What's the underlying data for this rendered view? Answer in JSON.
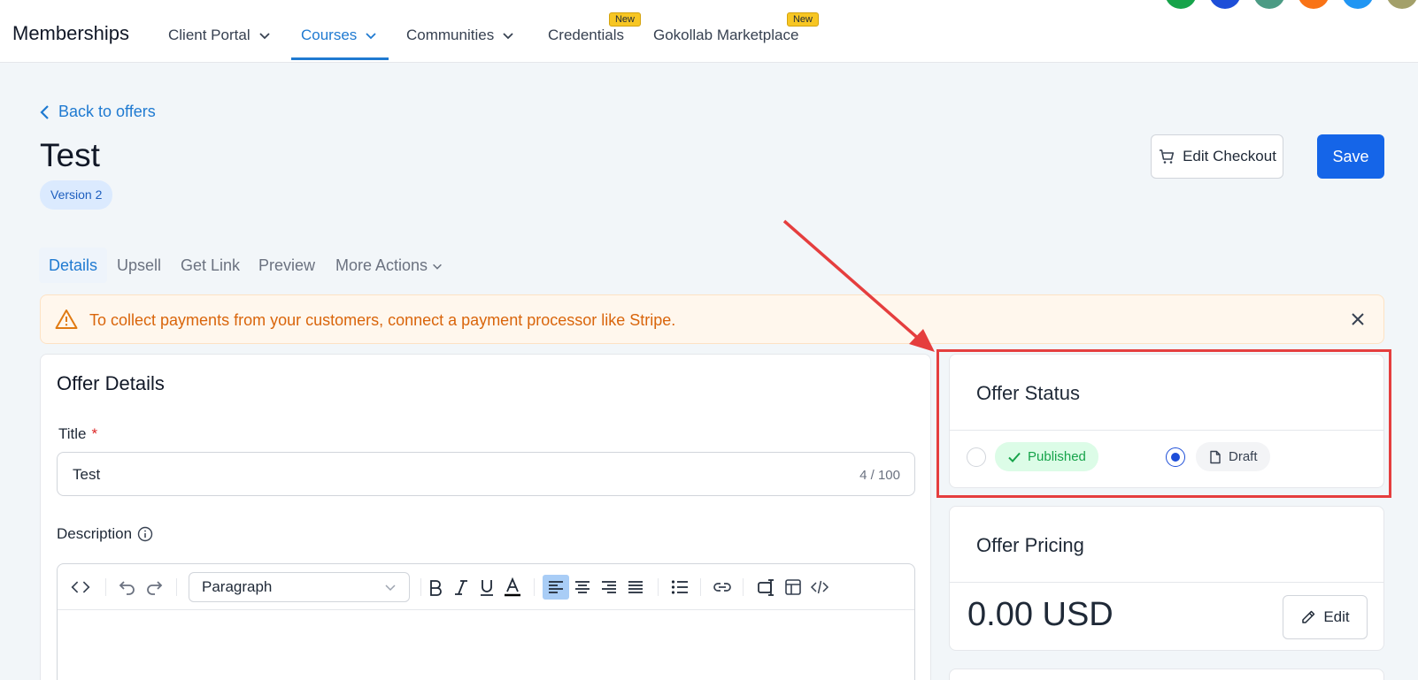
{
  "nav": {
    "brand": "Memberships",
    "items": [
      {
        "label": "Client Portal"
      },
      {
        "label": "Courses"
      },
      {
        "label": "Communities"
      },
      {
        "label": "Credentials",
        "badge": "New"
      },
      {
        "label": "Gokollab Marketplace",
        "badge": "New"
      }
    ],
    "active_color": "#1f7ad1"
  },
  "back_link": "Back to offers",
  "page": {
    "title": "Test",
    "version": "Version 2"
  },
  "actions": {
    "edit_checkout": "Edit Checkout",
    "save": "Save"
  },
  "tabs": [
    "Details",
    "Upsell",
    "Get Link",
    "Preview",
    "More Actions"
  ],
  "alert": {
    "text": "To collect payments from your customers, connect a payment processor like Stripe."
  },
  "details": {
    "heading": "Offer Details",
    "title_label": "Title",
    "required_mark": "*",
    "title_value": "Test",
    "title_count": "4 / 100",
    "description_label": "Description",
    "paragraph_select": "Paragraph"
  },
  "status": {
    "heading": "Offer Status",
    "published_label": "Published",
    "draft_label": "Draft",
    "selected": "Draft"
  },
  "pricing": {
    "heading": "Offer Pricing",
    "price": "0.00 USD",
    "edit_label": "Edit"
  },
  "colors": {
    "primary": "#1565e8",
    "annotation": "#e53e3e",
    "warning": "#d9650b",
    "success": "#16a34a"
  }
}
